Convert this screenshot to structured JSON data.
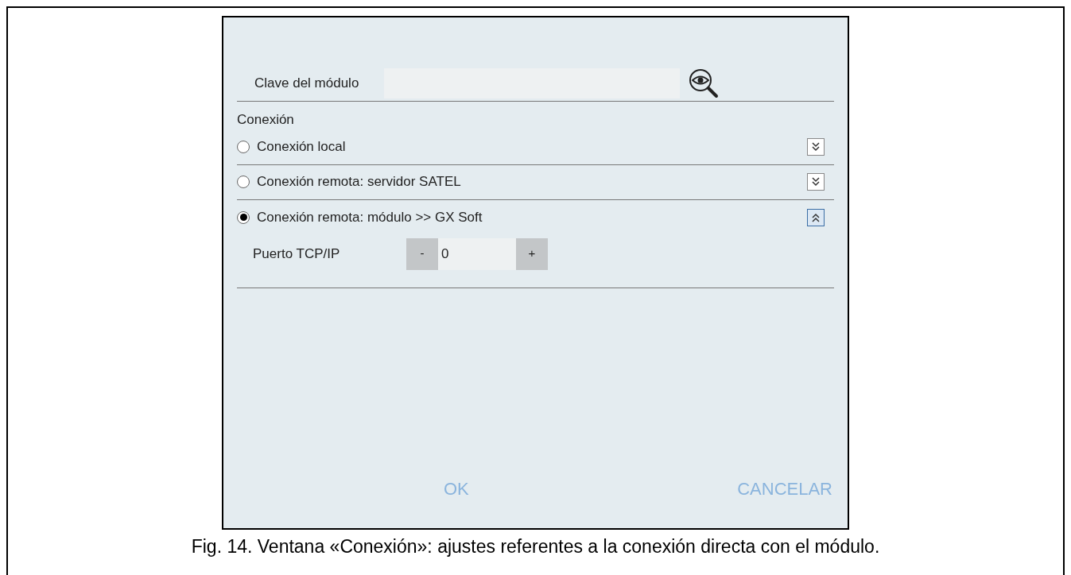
{
  "dialog": {
    "key_field": {
      "label": "Clave del módulo"
    },
    "section_title": "Conexión",
    "connections": [
      {
        "label": "Conexión local",
        "selected": false,
        "expanded": false
      },
      {
        "label": "Conexión remota: servidor SATEL",
        "selected": false,
        "expanded": false
      },
      {
        "label": "Conexión remota: módulo >> GX Soft",
        "selected": true,
        "expanded": true
      }
    ],
    "port": {
      "label": "Puerto TCP/IP",
      "decrement": "-",
      "value": "0",
      "increment": "+"
    },
    "buttons": [
      "OK",
      "CANCELAR"
    ]
  },
  "caption": "Fig. 14. Ventana «Conexión»: ajustes referentes a la conexión directa con el módulo."
}
